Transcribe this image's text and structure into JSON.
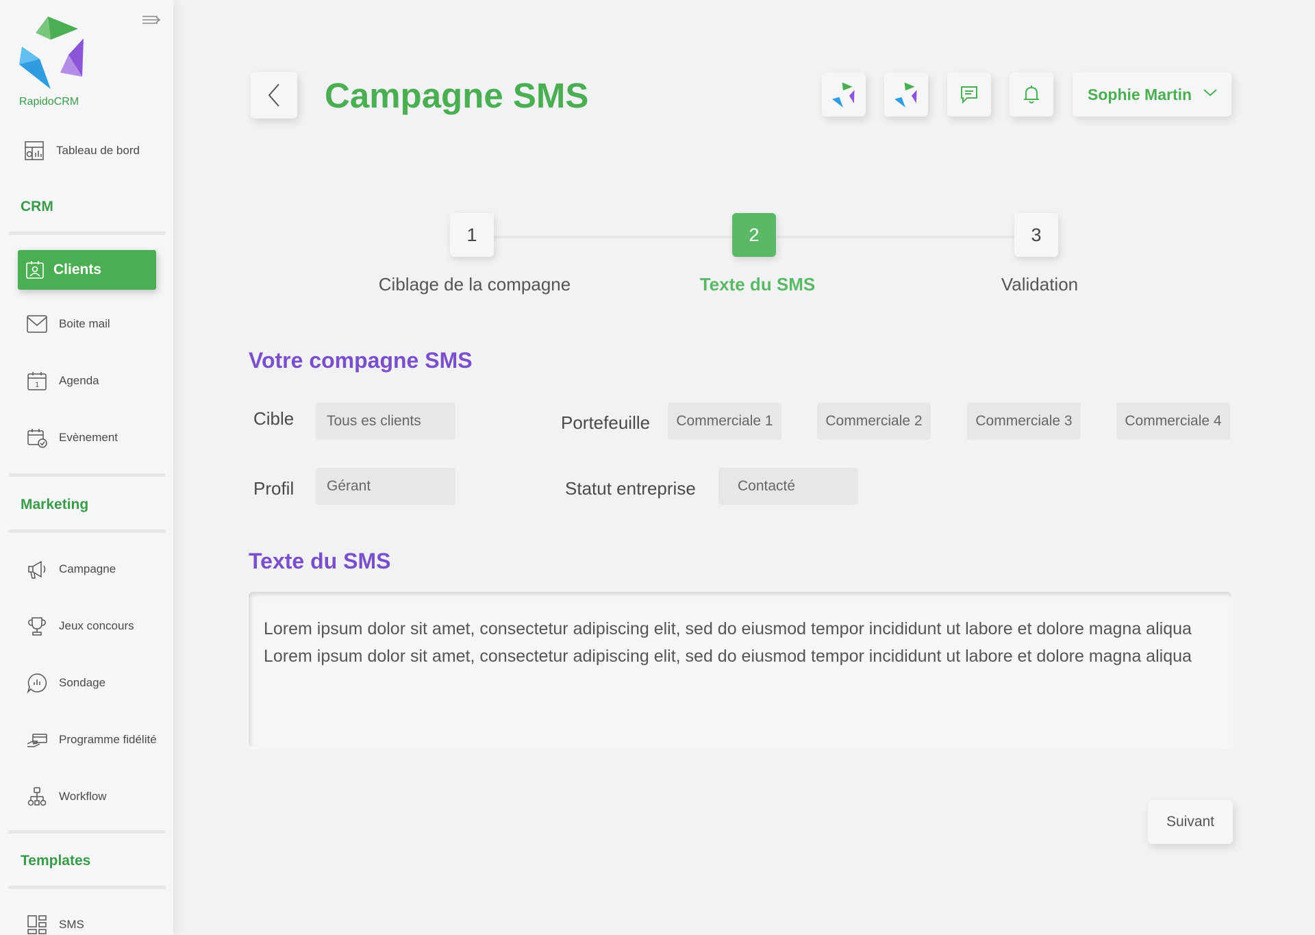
{
  "app": {
    "brand": "RapidoCRM"
  },
  "sidebar": {
    "dashboard": {
      "label": "Tableau de bord",
      "icon": "dashboard-icon"
    },
    "sections": {
      "crm": "CRM",
      "marketing": "Marketing",
      "templates": "Templates"
    },
    "crm_items": [
      {
        "label": "Clients",
        "icon": "contact-card-icon",
        "active": true
      },
      {
        "label": "Boite mail",
        "icon": "mail-icon"
      },
      {
        "label": "Agenda",
        "icon": "calendar-icon"
      },
      {
        "label": "Evènement",
        "icon": "event-icon"
      }
    ],
    "marketing_items": [
      {
        "label": "Campagne",
        "icon": "megaphone-icon"
      },
      {
        "label": "Jeux concours",
        "icon": "trophy-icon"
      },
      {
        "label": "Sondage",
        "icon": "poll-icon"
      },
      {
        "label": "Programme fidélité",
        "icon": "loyalty-card-icon"
      },
      {
        "label": "Workflow",
        "icon": "workflow-icon"
      }
    ],
    "templates_items": [
      {
        "label": "SMS",
        "icon": "template-icon"
      }
    ]
  },
  "header": {
    "title": "Campagne SMS",
    "user_name": "Sophie Martin",
    "icons": [
      "brand-logo-icon",
      "brand-logo-icon",
      "chat-icon",
      "bell-icon",
      "chevron-down-icon"
    ]
  },
  "stepper": {
    "steps": [
      {
        "number": "1",
        "label": "Ciblage de la compagne",
        "active": false
      },
      {
        "number": "2",
        "label": "Texte du SMS",
        "active": true
      },
      {
        "number": "3",
        "label": "Validation",
        "active": false
      }
    ]
  },
  "form": {
    "section_title": "Votre compagne SMS",
    "cible": {
      "label": "Cible",
      "value": "Tous es clients"
    },
    "portefeuille": {
      "label": "Portefeuille",
      "options": [
        "Commerciale 1",
        "Commerciale 2",
        "Commerciale 3",
        "Commerciale 4"
      ]
    },
    "profil": {
      "label": "Profil",
      "value": "Gérant"
    },
    "statut": {
      "label": "Statut entreprise",
      "value": "Contacté"
    },
    "sms_section_title": "Texte du SMS",
    "sms_text": "Lorem ipsum dolor sit amet, consectetur adipiscing elit, sed do eiusmod tempor incididunt ut labore et dolore magna aliqua\nLorem ipsum dolor sit amet, consectetur adipiscing elit, sed do eiusmod tempor incididunt ut labore et dolore magna aliqua",
    "next_label": "Suivant"
  },
  "colors": {
    "accent_green": "#4cae52",
    "accent_purple": "#7a4fc9",
    "background": "#f1f2f4"
  }
}
